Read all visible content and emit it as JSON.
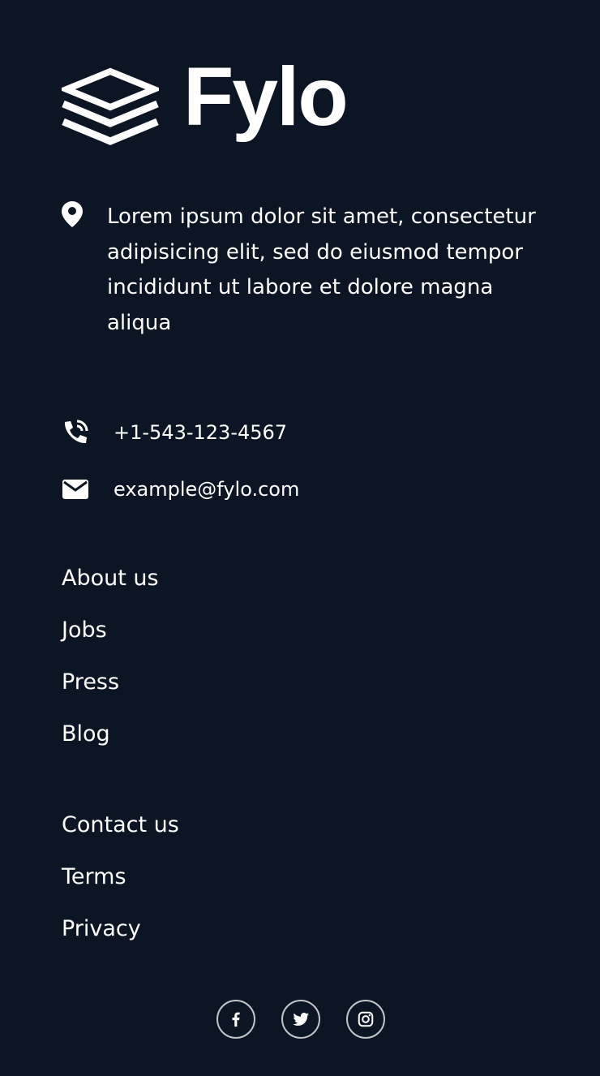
{
  "brand": {
    "name": "Fylo"
  },
  "contact": {
    "address": "Lorem ipsum dolor sit amet, consectetur adipisicing elit, sed do eiusmod tempor incididunt ut labore et dolore magna aliqua",
    "phone": "+1-543-123-4567",
    "email": "example@fylo.com"
  },
  "links_primary": [
    {
      "label": "About us"
    },
    {
      "label": "Jobs"
    },
    {
      "label": "Press"
    },
    {
      "label": "Blog"
    }
  ],
  "links_secondary": [
    {
      "label": "Contact us"
    },
    {
      "label": "Terms"
    },
    {
      "label": "Privacy"
    }
  ],
  "social": [
    {
      "icon": "facebook-icon"
    },
    {
      "icon": "twitter-icon"
    },
    {
      "icon": "instagram-icon"
    }
  ],
  "colors": {
    "background": "#0c1524",
    "text": "#ffffff"
  }
}
